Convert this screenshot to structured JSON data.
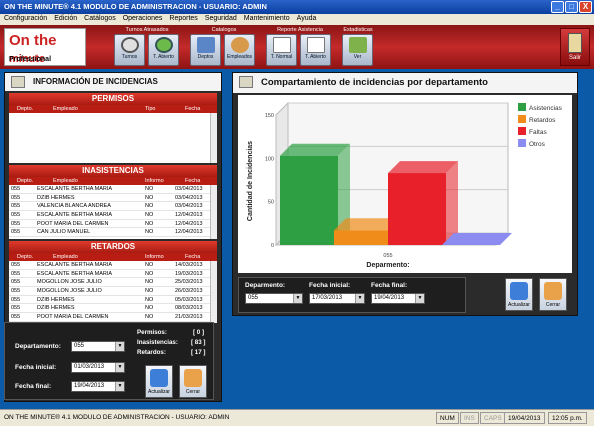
{
  "window": {
    "title": "ON THE MINUTE® 4.1 MODULO DE ADMINISTRACION  -  USUARIO: ADMIN",
    "min": "_",
    "max": "□",
    "close": "X"
  },
  "menu": [
    "Configuración",
    "Edición",
    "Catálogos",
    "Operaciones",
    "Reportes",
    "Seguridad",
    "Mantenimiento",
    "Ayuda"
  ],
  "logo": {
    "line1": "On the",
    "line2": "minute",
    "sub": "Professional"
  },
  "toolbar": {
    "groups": [
      "Turnos Atrasados",
      "Catalogos",
      "Reporte Asistencia",
      "Estadisticas"
    ],
    "buttons": [
      "Turnos",
      "T. Abierto",
      "Deptos",
      "Empleados",
      "T. Normal",
      "T. Abierto",
      "Ver"
    ],
    "exit": "Salir"
  },
  "left": {
    "title": "INFORMACIÓN DE INCIDENCIAS",
    "permisos": {
      "title": "PERMISOS",
      "cols": [
        "Depto.",
        "Empleado",
        "Tipo",
        "Fecha"
      ],
      "rows": []
    },
    "inasistencias": {
      "title": "INASISTENCIAS",
      "cols": [
        "Depto.",
        "Empleado",
        "Informo",
        "Fecha"
      ],
      "rows": [
        [
          "055",
          "ESCALANTE BERTHA MARIA",
          "NO",
          "03/04/2013"
        ],
        [
          "055",
          "DZIB HERMES",
          "NO",
          "03/04/2013"
        ],
        [
          "055",
          "VALENCIA BLANCA ANDREA",
          "NO",
          "03/04/2013"
        ],
        [
          "055",
          "ESCALANTE BERTHA MARIA",
          "NO",
          "12/04/2013"
        ],
        [
          "055",
          "POOT MARIA DEL CARMEN",
          "NO",
          "12/04/2013"
        ],
        [
          "055",
          "CAN JULIO MANUEL",
          "NO",
          "12/04/2013"
        ]
      ]
    },
    "retardos": {
      "title": "RETARDOS",
      "cols": [
        "Depto.",
        "Empleado",
        "Informo",
        "Fecha"
      ],
      "rows": [
        [
          "055",
          "ESCALANTE BERTHA MARIA",
          "NO",
          "14/03/2013"
        ],
        [
          "055",
          "ESCALANTE BERTHA MARIA",
          "NO",
          "19/03/2013"
        ],
        [
          "055",
          "MOGOLLON JOSE JULIO",
          "NO",
          "25/03/2013"
        ],
        [
          "055",
          "MOGOLLON JOSE JULIO",
          "NO",
          "26/03/2013"
        ],
        [
          "055",
          "DZIB HERMES",
          "NO",
          "05/03/2013"
        ],
        [
          "055",
          "DZIB HERMES",
          "NO",
          "08/03/2013"
        ],
        [
          "055",
          "POOT MARIA DEL CARMEN",
          "NO",
          "21/03/2013"
        ]
      ]
    },
    "filters": {
      "depto_label": "Departamento:",
      "depto": "055",
      "fi_label": "Fecha inicial:",
      "fi": "01/03/2013",
      "ff_label": "Fecha final:",
      "ff": "19/04/2013"
    },
    "stats": {
      "permisos_label": "Permisos:",
      "permisos": "[ 0 ]",
      "inas_label": "Inasistencias:",
      "inas": "[ 83 ]",
      "ret_label": "Retardos:",
      "ret": "[ 17 ]"
    },
    "buttons": {
      "update": "Actualizar",
      "close": "Cerrar"
    }
  },
  "right": {
    "title": "Compartamiento de incidencias por departamento",
    "filters": {
      "depto_label": "Deparmento:",
      "depto": "055",
      "fi_label": "Fecha inicial:",
      "fi": "17/03/2013",
      "ff_label": "Fecha final:",
      "ff": "19/04/2013"
    },
    "buttons": {
      "update": "Actualizar",
      "close": "Cerrar"
    }
  },
  "chart_data": {
    "type": "bar",
    "categories": [
      "055"
    ],
    "series": [
      {
        "name": "Asistencias",
        "values": [
          103
        ],
        "color": "#2ea043"
      },
      {
        "name": "Retardos",
        "values": [
          17
        ],
        "color": "#f08c1a"
      },
      {
        "name": "Faltas",
        "values": [
          83
        ],
        "color": "#e8202a"
      },
      {
        "name": "Otros",
        "values": [
          0
        ],
        "color": "#8c8cf0"
      }
    ],
    "xlabel": "Deparmento:",
    "ylabel": "Cantidad de Incidencias",
    "yticks": [
      "0",
      "50",
      "100",
      "150"
    ],
    "ylim": [
      0,
      150
    ],
    "legend": "right"
  },
  "status": {
    "app": "ON THE MINUTE® 4.1 MODULO DE ADMINISTRACION  -  USUARIO: ADMIN",
    "num": "NUM",
    "ins": "INS",
    "caps": "CAPS",
    "date": "19/04/2013",
    "time": "12:05 p.m."
  }
}
